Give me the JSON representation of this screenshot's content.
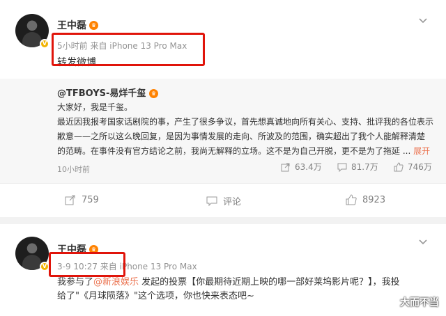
{
  "post1": {
    "author": "王中磊",
    "meta": "5小时前  来自 iPhone 13 Pro Max",
    "text": "转发微博",
    "repost": {
      "author": "@TFBOYS-易烊千玺",
      "lines": [
        "大家好，我是千玺。",
        "最近因我报考国家话剧院的事，产生了很多争议，首先想真诚地向所有关心、支持、批评我的各位表示",
        "歉意——之所以这么晚回复，是因为事情发展的走向、所波及的范围，确实超出了我个人能解释清楚",
        "的范畴。在事件没有官方结论之前，我尚无解释的立场。这不是为自己开脱，更不是为了拖延 ..."
      ],
      "expand": "展开",
      "time": "10小时前",
      "reposts": "63.4万",
      "comments": "81.7万",
      "likes": "746万"
    },
    "actions": {
      "repost": "759",
      "comment": "评论",
      "like": "8923"
    }
  },
  "post2": {
    "author": "王中磊",
    "meta": "3-9 10:27  来自 iPhone 13 Pro Max",
    "text_pre": "我参与了",
    "mention": "@新浪娱乐",
    "text_line1": " 发起的投票【你最期待近期上映的哪一部好莱坞影片呢？】，我投",
    "text_line2": "给了\"《月球陨落》\"这个选项，你也快来表态吧~"
  },
  "watermark": "大而不当",
  "colors": {
    "highlight_box": "#e0140a",
    "accent": "#eb7350",
    "badge": "#f2b300"
  }
}
